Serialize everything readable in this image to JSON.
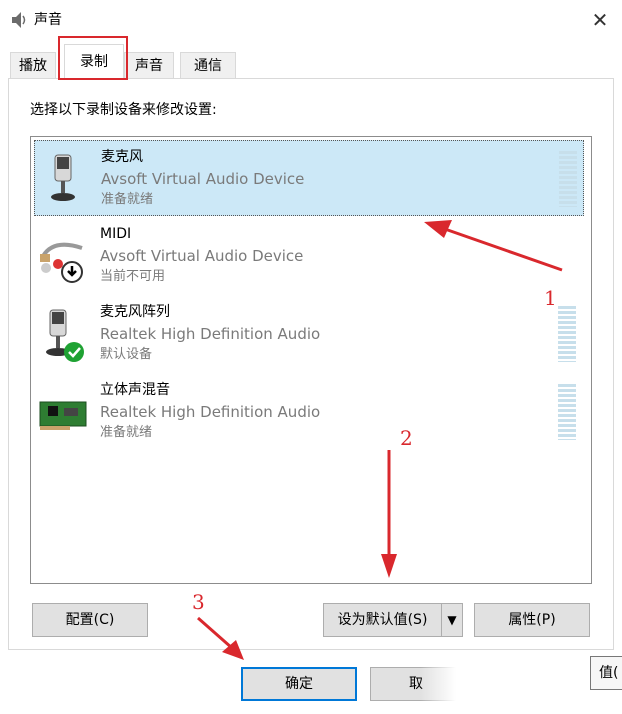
{
  "window": {
    "title": "声音",
    "close_glyph": "✕"
  },
  "tabs": [
    {
      "label": "播放"
    },
    {
      "label": "录制",
      "selected": true
    },
    {
      "label": "声音"
    },
    {
      "label": "通信"
    }
  ],
  "instruction": "选择以下录制设备来修改设置:",
  "devices": [
    {
      "name": "麦克风",
      "driver": "Avsoft Virtual Audio Device",
      "status": "准备就绪",
      "icon": "microphone-icon",
      "selected": true
    },
    {
      "name": "MIDI",
      "driver": "Avsoft Virtual Audio Device",
      "status": "当前不可用",
      "icon": "audio-cable-icon",
      "badge": "down-arrow-badge-icon"
    },
    {
      "name": "麦克风阵列",
      "driver": "Realtek High Definition Audio",
      "status": "默认设备",
      "icon": "microphone-icon",
      "badge": "check-badge-icon"
    },
    {
      "name": "立体声混音",
      "driver": "Realtek High Definition Audio",
      "status": "准备就绪",
      "icon": "sound-card-icon"
    }
  ],
  "buttons": {
    "configure": "配置(C)",
    "set_default": "设为默认值(S)",
    "set_default_dropdown": "▼",
    "properties": "属性(P)",
    "ok": "确定",
    "cancel": "取",
    "apply": "值("
  },
  "annotations": {
    "one": "1",
    "two": "2",
    "three": "3"
  },
  "colors": {
    "annotation": "#d9282d",
    "selection": "#cce8f7",
    "focus": "#0078d7"
  }
}
